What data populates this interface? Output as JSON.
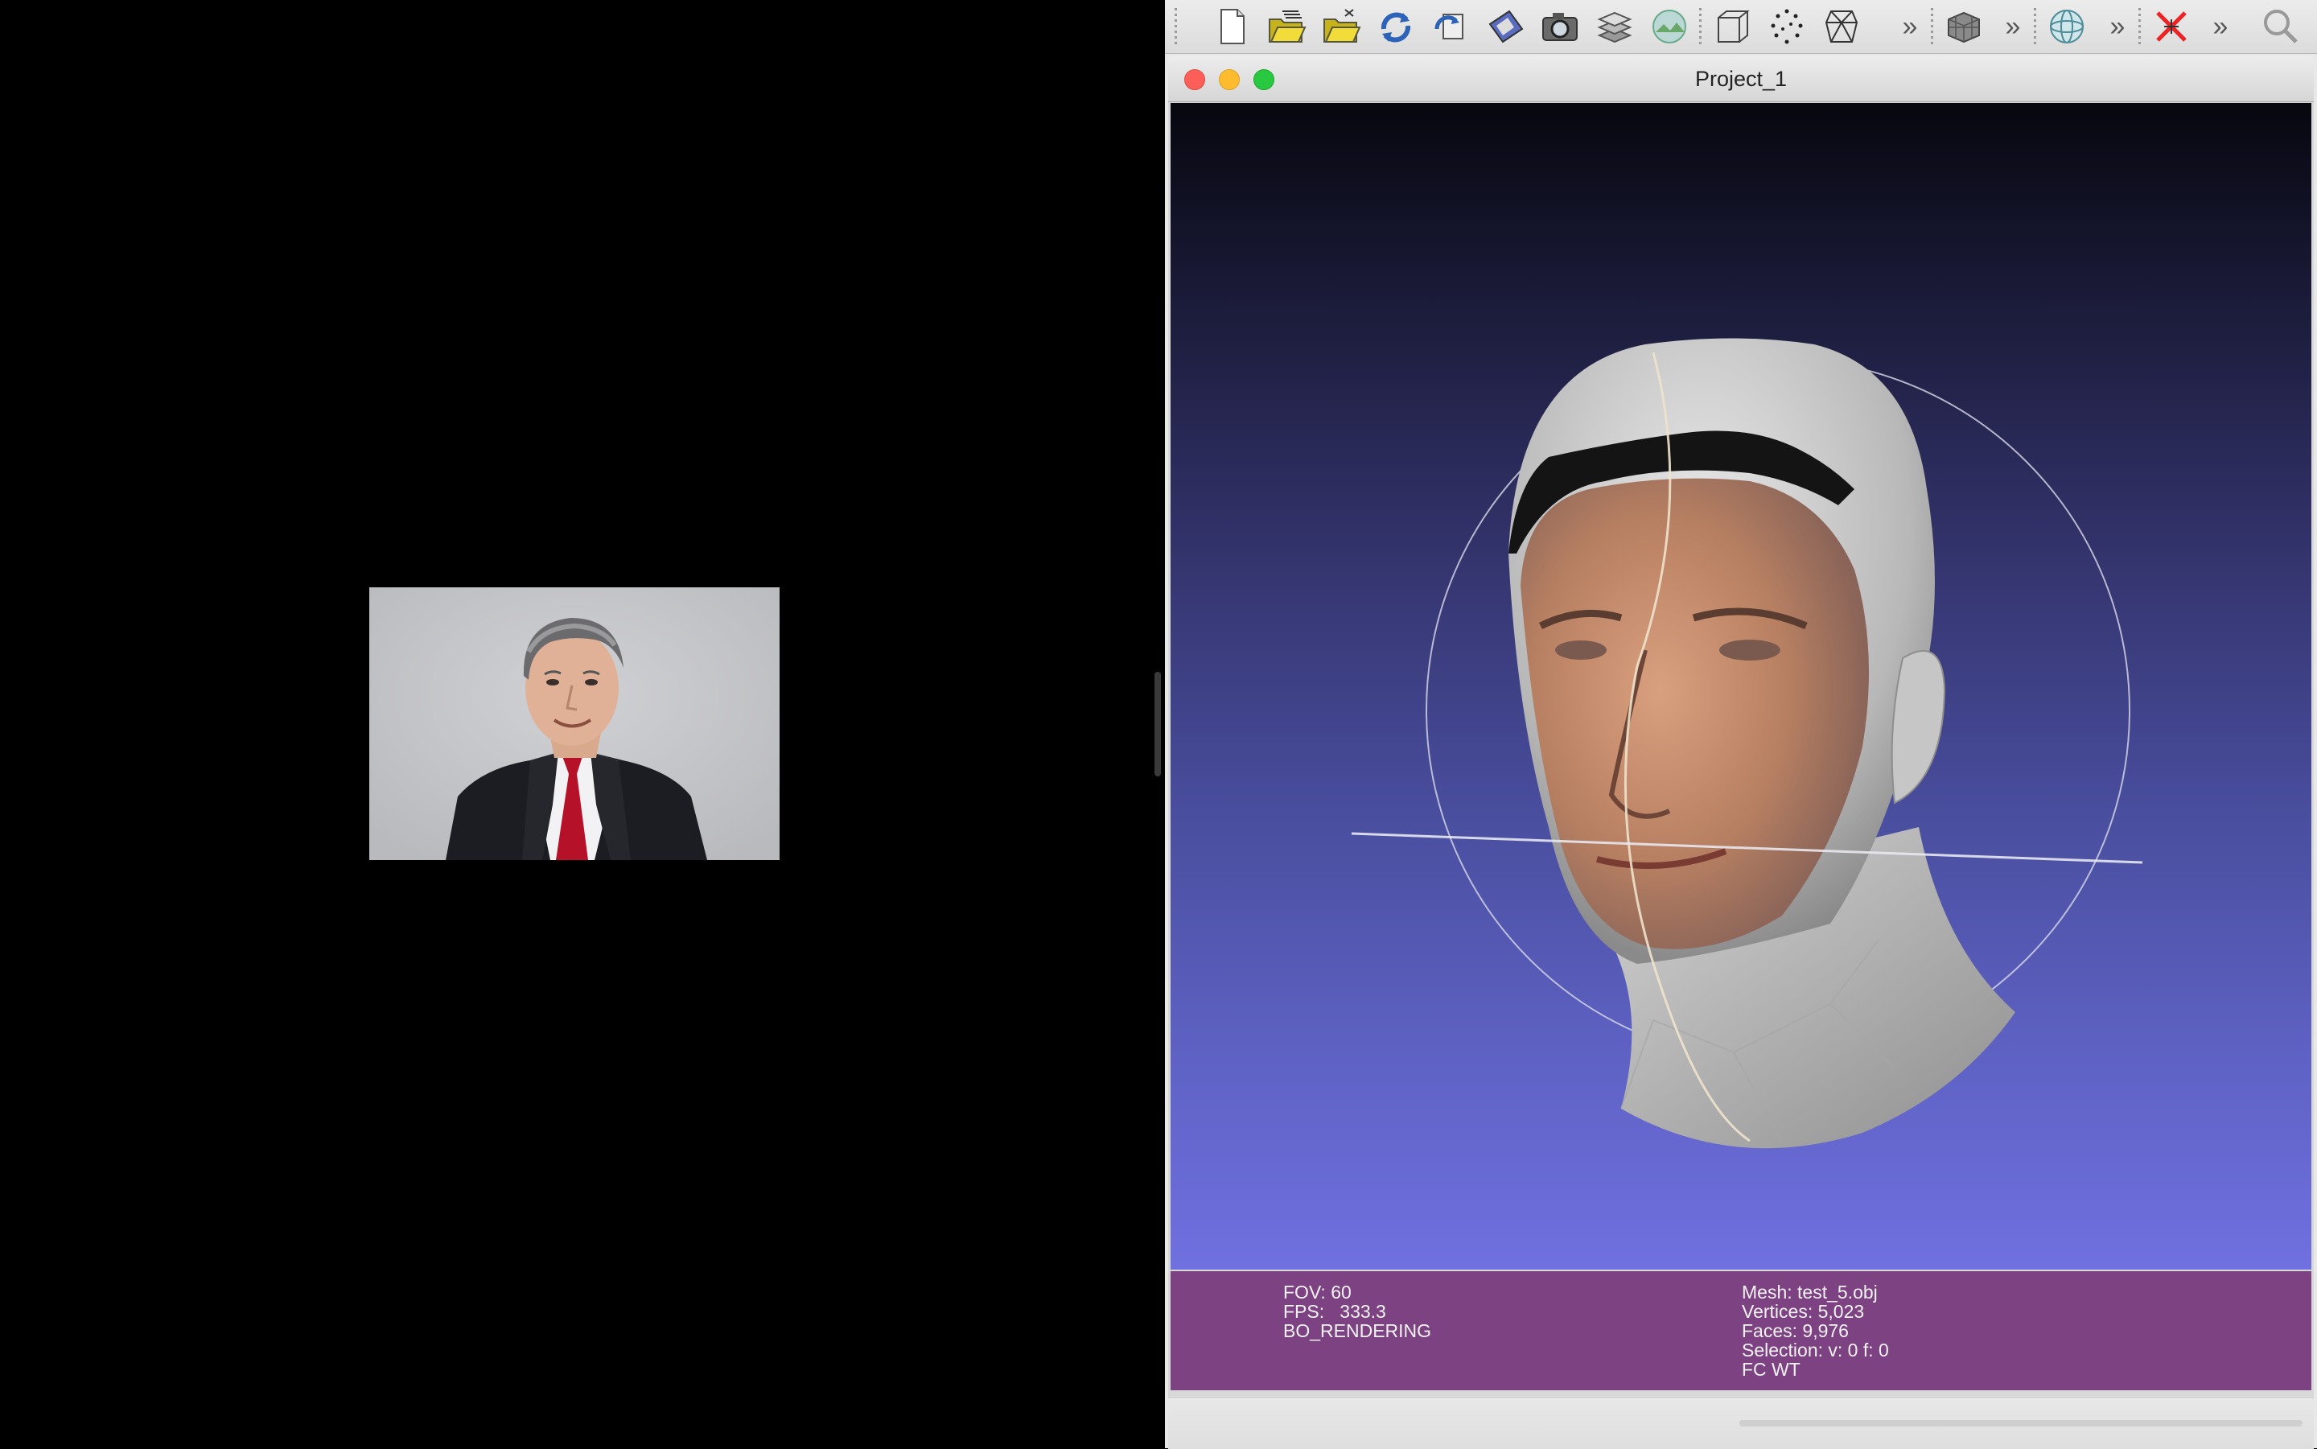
{
  "window": {
    "title": "Project_1"
  },
  "toolbar": {
    "buttons": [
      {
        "icon": "new-project-icon"
      },
      {
        "icon": "open-project-icon"
      },
      {
        "icon": "import-mesh-icon"
      },
      {
        "icon": "reload-icon"
      },
      {
        "icon": "reload-all-icon"
      },
      {
        "icon": "save-icon"
      },
      {
        "icon": "snapshot-camera-icon"
      },
      {
        "icon": "layers-icon"
      },
      {
        "icon": "raster-layers-icon"
      },
      {
        "icon": "bounding-box-icon"
      },
      {
        "icon": "points-render-icon"
      },
      {
        "icon": "wireframe-render-icon"
      },
      {
        "icon": "flat-lines-icon"
      },
      {
        "icon": "trackball-icon"
      },
      {
        "icon": "close-red-x-icon"
      },
      {
        "icon": "search-icon"
      }
    ],
    "overflow_glyph": "»"
  },
  "viewport": {
    "fov": "FOV: 60",
    "fps": "FPS:   333.3",
    "render_mode": "BO_RENDERING",
    "mesh": "Mesh: test_5.obj",
    "vertices": "Vertices: 5,023",
    "faces": "Faces: 9,976",
    "selection": "Selection: v: 0 f: 0",
    "shading": "FC WT"
  },
  "colors": {
    "info_panel": "#7c4282",
    "close_light": "#fc5f57",
    "minimize_light": "#fdbc2e",
    "zoom_light": "#28c840"
  }
}
